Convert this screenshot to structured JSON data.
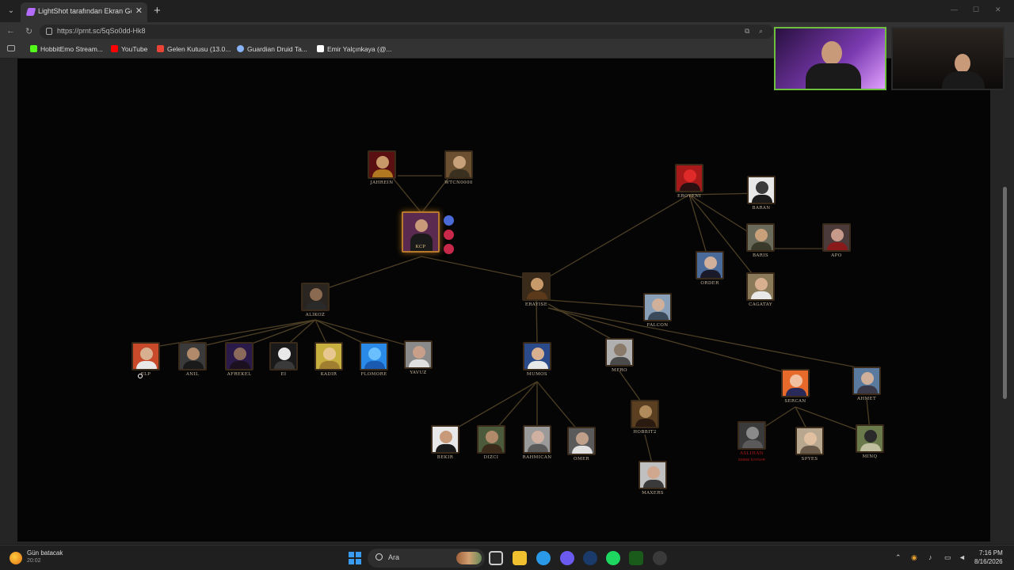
{
  "browser": {
    "tab": {
      "title": "LightShot tarafından Ekran Görün",
      "close": "✕"
    },
    "new_tab": "+",
    "url": "https://prnt.sc/5qSo0dd-Hk8",
    "bookmarks": [
      {
        "label": "HobbitEmo Stream...",
        "color": "#53fc18"
      },
      {
        "label": "YouTube",
        "color": "#ff0000"
      },
      {
        "label": "Gelen Kutusu (13.0...",
        "color": "#ea4335"
      },
      {
        "label": "Guardian Druid Ta...",
        "color": "#8ab4f8"
      },
      {
        "label": "Emir Yalçınkaya (@...",
        "color": "#ffffff"
      }
    ]
  },
  "tree": {
    "nodes": {
      "jahrein": "JAHREIN",
      "wtcn": "WTCN0000",
      "root": "KCP",
      "alikoz": "ALIKOZ",
      "erayise": "ERAYISE",
      "eroyeni": "EROYENI",
      "baran": "BARAN",
      "baris": "BARIS",
      "apo": "APO",
      "order": "ORDER",
      "cagatay": "CAGATAY",
      "falcon": "FALCON",
      "elp": "ELP",
      "anil": "ANIL",
      "afrekel": "AFREKEL",
      "ei": "EI",
      "kadir": "KADIR",
      "flomore": "FLOMORE",
      "yavuz": "YAVUZ",
      "mumos": "MUMOS",
      "mero": "MERO",
      "sercan": "SERCAN",
      "ahmet": "AHMET",
      "hobbit": "HOBBIT2",
      "bekir": "BEKIR",
      "dizci": "DIZCI",
      "rahmican": "RAHMICAN",
      "omer": "OMER",
      "maxers": "MAXERS",
      "spyes": "SPYES",
      "minq": "MINQ",
      "unknown": "ASLIHAN"
    },
    "unknown_sub": "EMINE KAYNAR"
  },
  "taskbar": {
    "weather_title": "Gün batacak",
    "weather_sub": "20:02",
    "search_placeholder": "Ara",
    "time": "7:16 PM",
    "date": "8/16/2026"
  }
}
